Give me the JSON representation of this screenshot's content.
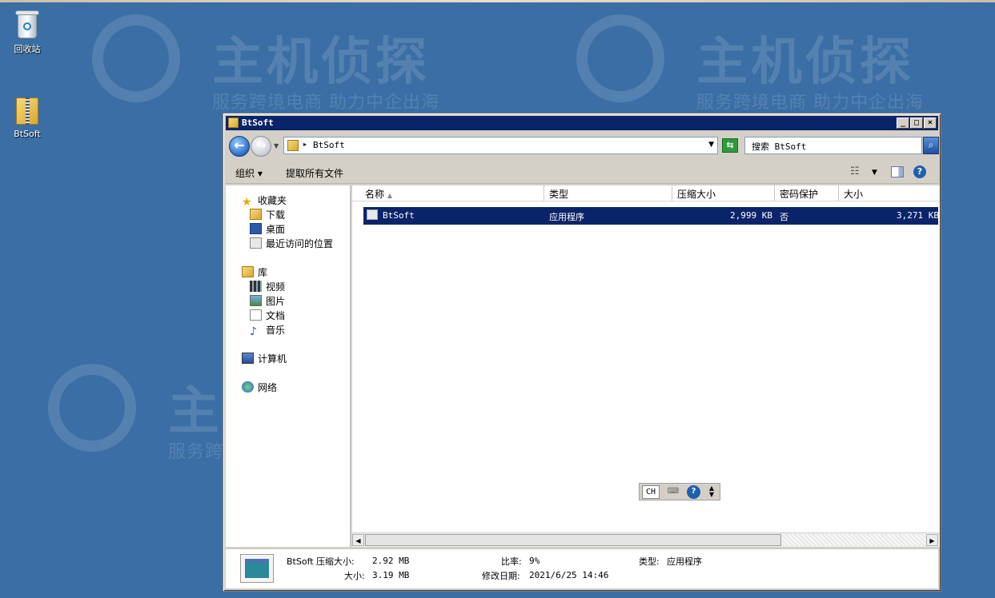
{
  "desktop": {
    "recycle_label": "回收站",
    "zip_label": "BtSoft"
  },
  "watermark": {
    "main": "主机侦探",
    "sub": "服务跨境电商 助力中企出海"
  },
  "window": {
    "title": "BtSoft",
    "minimize": "_",
    "maximize": "□",
    "close": "×"
  },
  "address": {
    "path": "BtSoft",
    "search_placeholder": "搜索 BtSoft"
  },
  "toolbar": {
    "organize": "组织 ▾",
    "extract_all": "提取所有文件"
  },
  "nav": {
    "favorites": "收藏夹",
    "downloads": "下载",
    "desktop": "桌面",
    "recent": "最近访问的位置",
    "libraries": "库",
    "videos": "视频",
    "pictures": "图片",
    "documents": "文档",
    "music": "音乐",
    "computer": "计算机",
    "network": "网络"
  },
  "columns": [
    "名称",
    "类型",
    "压缩大小",
    "密码保护",
    "大小"
  ],
  "files": [
    {
      "name": "BtSoft",
      "type": "应用程序",
      "compressed": "2,999 KB",
      "password": "否",
      "size": "3,271 KB"
    }
  ],
  "ime": {
    "lang": "CH",
    "help": "?"
  },
  "details": {
    "name_label": "BtSoft 压缩大小:",
    "compressed": "2.92 MB",
    "size_label": "大小:",
    "size": "3.19 MB",
    "ratio_label": "比率:",
    "ratio": "9%",
    "modified_label": "修改日期:",
    "modified": "2021/6/25 14:46",
    "type_label": "类型:",
    "type": "应用程序"
  }
}
